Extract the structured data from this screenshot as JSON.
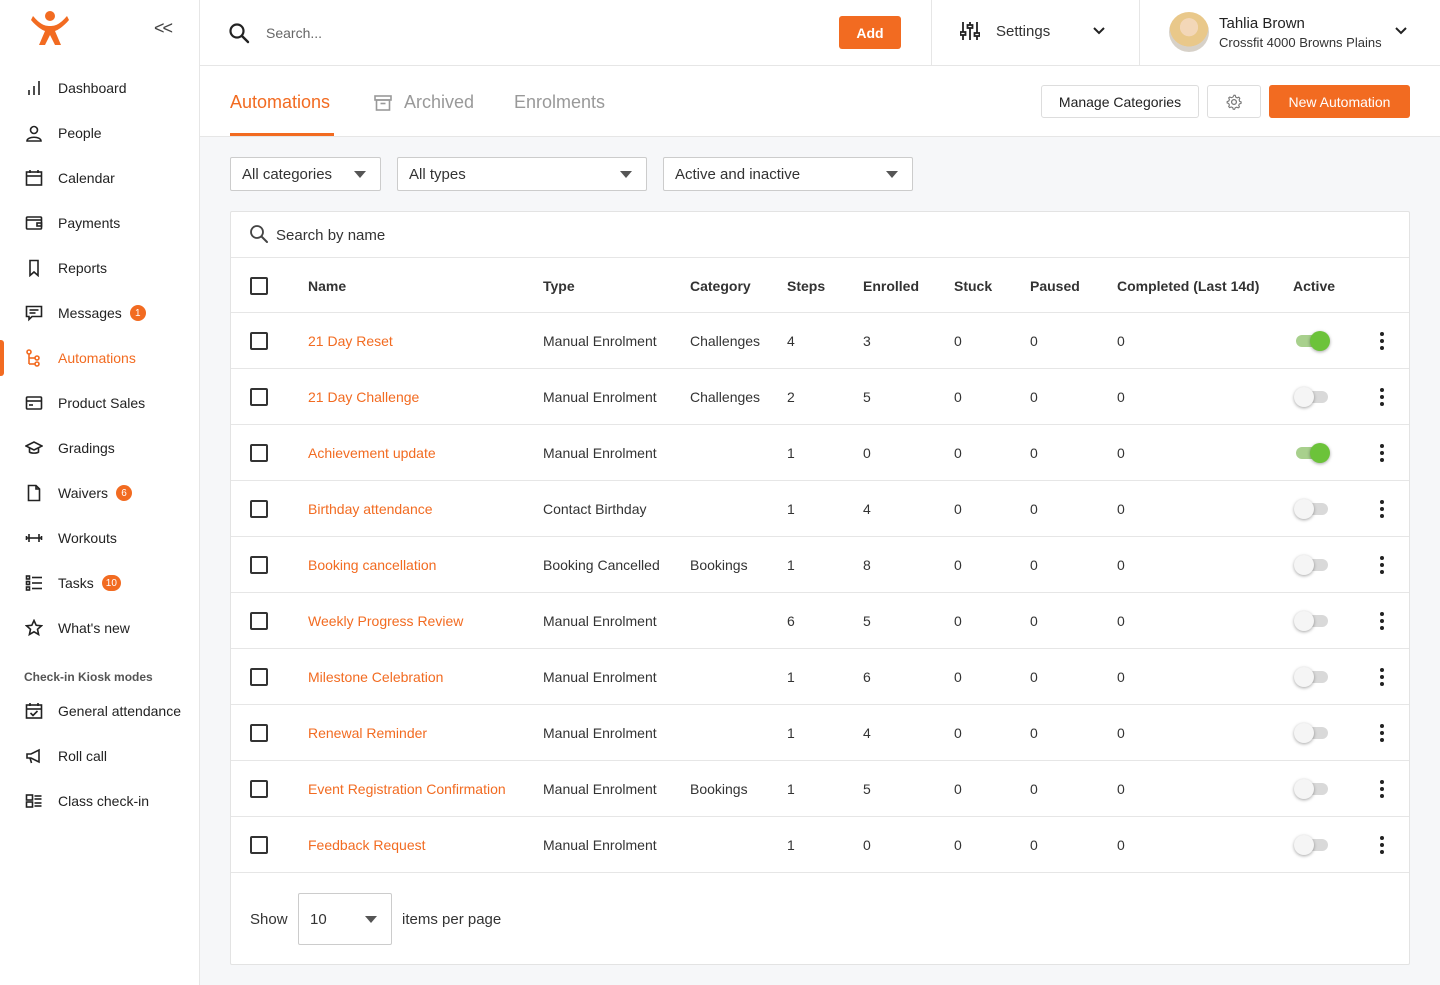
{
  "sidebar": {
    "collapse_glyph": "<<",
    "items": [
      {
        "label": "Dashboard",
        "icon": "bar-chart-icon"
      },
      {
        "label": "People",
        "icon": "person-icon"
      },
      {
        "label": "Calendar",
        "icon": "calendar-icon"
      },
      {
        "label": "Payments",
        "icon": "wallet-icon"
      },
      {
        "label": "Reports",
        "icon": "bookmark-icon"
      },
      {
        "label": "Messages",
        "icon": "message-icon",
        "badge": "1"
      },
      {
        "label": "Automations",
        "icon": "automation-icon",
        "active": true
      },
      {
        "label": "Product Sales",
        "icon": "card-icon"
      },
      {
        "label": "Gradings",
        "icon": "graduation-cap-icon"
      },
      {
        "label": "Waivers",
        "icon": "document-icon",
        "badge": "6"
      },
      {
        "label": "Workouts",
        "icon": "dumbbell-icon"
      },
      {
        "label": "Tasks",
        "icon": "checklist-icon",
        "badge": "10"
      },
      {
        "label": "What's new",
        "icon": "star-icon"
      }
    ],
    "section_label": "Check-in Kiosk modes",
    "kiosk_items": [
      {
        "label": "General attendance",
        "icon": "calendar-check-icon"
      },
      {
        "label": "Roll call",
        "icon": "megaphone-icon"
      },
      {
        "label": "Class check-in",
        "icon": "grid-list-icon"
      }
    ]
  },
  "header": {
    "search_placeholder": "Search...",
    "add_label": "Add",
    "settings_label": "Settings",
    "user_name": "Tahlia Brown",
    "user_org": "Crossfit 4000 Browns Plains"
  },
  "tabs": {
    "automations": "Automations",
    "archived": "Archived",
    "enrolments": "Enrolments",
    "manage_categories": "Manage Categories",
    "new_automation": "New Automation"
  },
  "filters": {
    "category": "All categories",
    "type": "All types",
    "status": "Active and inactive"
  },
  "table": {
    "search_placeholder": "Search by name",
    "columns": {
      "name": "Name",
      "type": "Type",
      "category": "Category",
      "steps": "Steps",
      "enrolled": "Enrolled",
      "stuck": "Stuck",
      "paused": "Paused",
      "completed": "Completed (Last 14d)",
      "active": "Active"
    },
    "rows": [
      {
        "name": "21 Day Reset",
        "type": "Manual Enrolment",
        "category": "Challenges",
        "steps": "4",
        "enrolled": "3",
        "stuck": "0",
        "paused": "0",
        "completed": "0",
        "active": true
      },
      {
        "name": "21 Day Challenge",
        "type": "Manual Enrolment",
        "category": "Challenges",
        "steps": "2",
        "enrolled": "5",
        "stuck": "0",
        "paused": "0",
        "completed": "0",
        "active": false
      },
      {
        "name": "Achievement update",
        "type": "Manual Enrolment",
        "category": "",
        "steps": "1",
        "enrolled": "0",
        "stuck": "0",
        "paused": "0",
        "completed": "0",
        "active": true
      },
      {
        "name": "Birthday attendance",
        "type": "Contact Birthday",
        "category": "",
        "steps": "1",
        "enrolled": "4",
        "stuck": "0",
        "paused": "0",
        "completed": "0",
        "active": false
      },
      {
        "name": "Booking cancellation",
        "type": "Booking Cancelled",
        "category": "Bookings",
        "steps": "1",
        "enrolled": "8",
        "stuck": "0",
        "paused": "0",
        "completed": "0",
        "active": false
      },
      {
        "name": "Weekly Progress Review",
        "type": "Manual Enrolment",
        "category": "",
        "steps": "6",
        "enrolled": "5",
        "stuck": "0",
        "paused": "0",
        "completed": "0",
        "active": false
      },
      {
        "name": "Milestone Celebration",
        "type": "Manual Enrolment",
        "category": "",
        "steps": "1",
        "enrolled": "6",
        "stuck": "0",
        "paused": "0",
        "completed": "0",
        "active": false
      },
      {
        "name": "Renewal Reminder",
        "type": "Manual Enrolment",
        "category": "",
        "steps": "1",
        "enrolled": "4",
        "stuck": "0",
        "paused": "0",
        "completed": "0",
        "active": false
      },
      {
        "name": "Event Registration Confirmation",
        "type": "Manual Enrolment",
        "category": "Bookings",
        "steps": "1",
        "enrolled": "5",
        "stuck": "0",
        "paused": "0",
        "completed": "0",
        "active": false
      },
      {
        "name": "Feedback Request",
        "type": "Manual Enrolment",
        "category": "",
        "steps": "1",
        "enrolled": "0",
        "stuck": "0",
        "paused": "0",
        "completed": "0",
        "active": false
      }
    ]
  },
  "pagination": {
    "show_label": "Show",
    "per_page": "10",
    "items_label": "items per page"
  },
  "colors": {
    "accent": "#f26b21",
    "toggle_on": "#6cc33a"
  }
}
